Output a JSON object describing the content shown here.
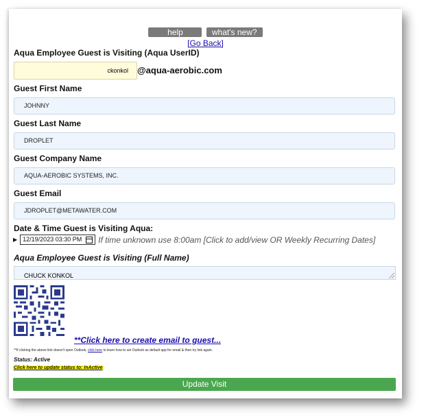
{
  "top_buttons": {
    "help": "help",
    "whats_new": "what's new?"
  },
  "go_back": "[Go Back]",
  "employee_userid": {
    "label": "Aqua Employee Guest is Visiting (Aqua UserID)",
    "value": "ckonkol",
    "domain": "@aqua-aerobic.com"
  },
  "guest_first_name": {
    "label": "Guest First Name",
    "value": "JOHNNY"
  },
  "guest_last_name": {
    "label": "Guest Last Name",
    "value": "DROPLET"
  },
  "guest_company": {
    "label": "Guest Company Name",
    "value": "AQUA-AEROBIC SYSTEMS, INC."
  },
  "guest_email": {
    "label": "Guest Email",
    "value": "JDROPLET@METAWATER.COM"
  },
  "visit_datetime": {
    "label": "Date & Time Guest is Visiting Aqua:",
    "value": "12/19/2023 03:30 PM",
    "hint": "If time unknown use 8:00am [Click to add/view OR Weekly Recurring Dates]"
  },
  "employee_fullname": {
    "label": "Aqua Employee Guest is Visiting (Full Name)",
    "value": "CHUCK KONKOL"
  },
  "create_email_link": "**Click here to create email to guest...",
  "outlook_note": {
    "prefix": "**If clicking the above link doesn't open Outlook,",
    "link": "click here",
    "suffix": "to learn how to set Outlook as default app for email & then try link again."
  },
  "status": "Status: Active",
  "update_status_link": "Click here to update status to: InActive",
  "update_button": "Update Visit",
  "colors": {
    "update_button": "#4aa74f",
    "highlight": "#ffff00",
    "link": "#1a0dab",
    "field_bg": "#eef5fd"
  }
}
